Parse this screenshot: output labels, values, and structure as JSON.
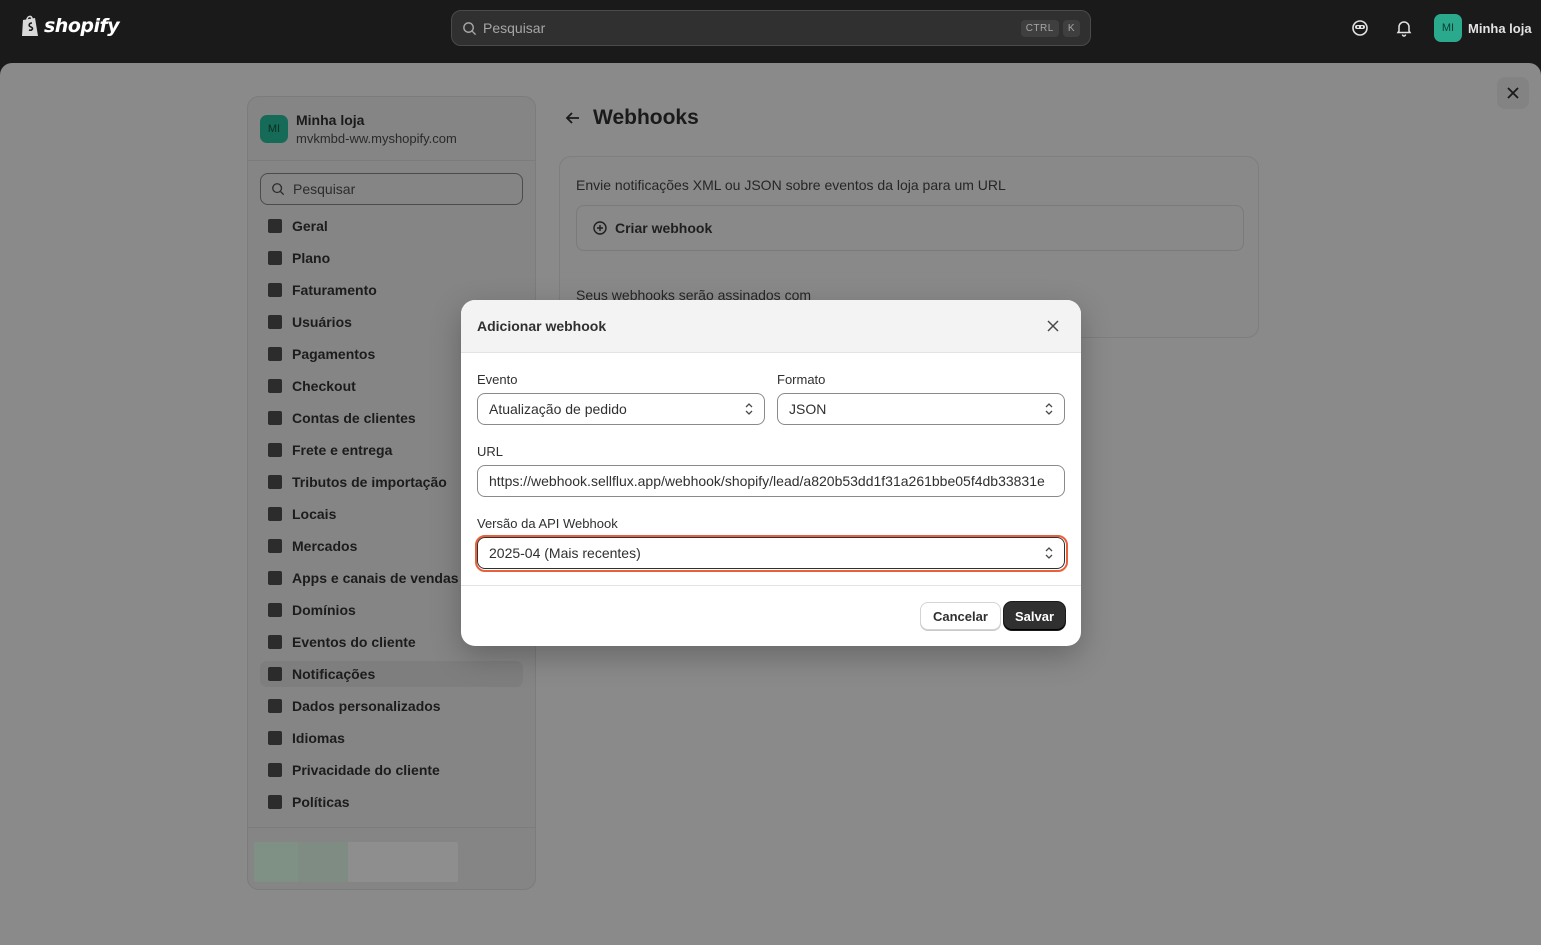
{
  "topbar": {
    "brand": "shopify",
    "search_placeholder": "Pesquisar",
    "kbd_ctrl": "CTRL",
    "kbd_k": "K",
    "store_initials": "MI",
    "store_name": "Minha loja"
  },
  "sidebar": {
    "store_initials": "MI",
    "store_name": "Minha loja",
    "store_url": "mvkmbd-ww.myshopify.com",
    "search_placeholder": "Pesquisar",
    "items": [
      {
        "label": "Geral",
        "icon": "store-icon"
      },
      {
        "label": "Plano",
        "icon": "plan-icon"
      },
      {
        "label": "Faturamento",
        "icon": "billing-icon"
      },
      {
        "label": "Usuários",
        "icon": "users-icon"
      },
      {
        "label": "Pagamentos",
        "icon": "payments-icon"
      },
      {
        "label": "Checkout",
        "icon": "cart-icon"
      },
      {
        "label": "Contas de clientes",
        "icon": "person-icon"
      },
      {
        "label": "Frete e entrega",
        "icon": "truck-icon"
      },
      {
        "label": "Tributos de importação",
        "icon": "duties-icon"
      },
      {
        "label": "Locais",
        "icon": "location-icon"
      },
      {
        "label": "Mercados",
        "icon": "globe-icon"
      },
      {
        "label": "Apps e canais de vendas",
        "icon": "apps-icon"
      },
      {
        "label": "Domínios",
        "icon": "domains-icon"
      },
      {
        "label": "Eventos do cliente",
        "icon": "events-icon"
      },
      {
        "label": "Notificações",
        "icon": "bell-icon"
      },
      {
        "label": "Dados personalizados",
        "icon": "data-icon"
      },
      {
        "label": "Idiomas",
        "icon": "language-icon"
      },
      {
        "label": "Privacidade do cliente",
        "icon": "lock-icon"
      },
      {
        "label": "Políticas",
        "icon": "policy-icon"
      }
    ],
    "active_item": "Notificações"
  },
  "page": {
    "title": "Webhooks",
    "description": "Envie notificações XML ou JSON sobre eventos da loja para um URL",
    "create_button": "Criar webhook",
    "signed_text": "Seus webhooks serão assinados com"
  },
  "modal": {
    "title": "Adicionar webhook",
    "event_label": "Evento",
    "event_value": "Atualização de pedido",
    "format_label": "Formato",
    "format_value": "JSON",
    "url_label": "URL",
    "url_value": "https://webhook.sellflux.app/webhook/shopify/lead/a820b53dd1f31a261bbe05f4db33831e",
    "api_label": "Versão da API Webhook",
    "api_value": "2025-04 (Mais recentes)",
    "cancel_label": "Cancelar",
    "save_label": "Salvar"
  },
  "colors": {
    "accent_focus": "#e8613c",
    "avatar_green": "#2ba98c",
    "primary_button": "#303030"
  }
}
